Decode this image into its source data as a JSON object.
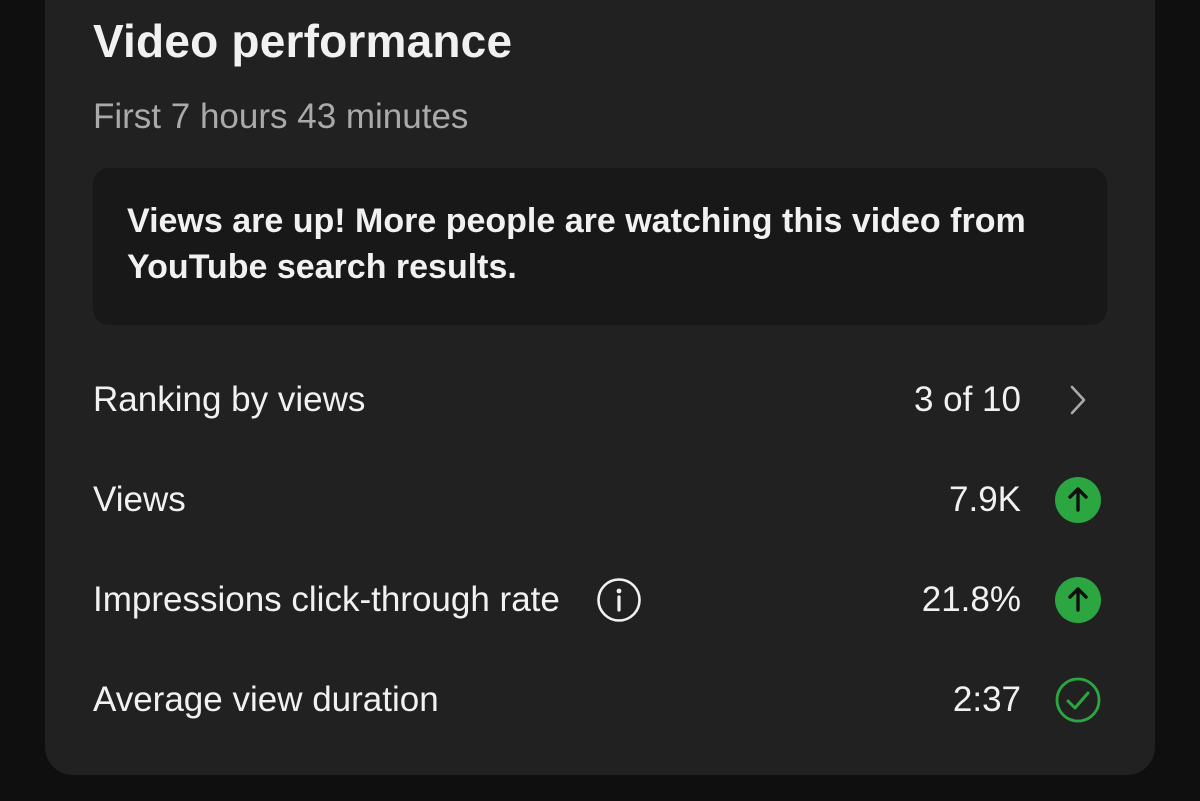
{
  "card": {
    "title": "Video performance",
    "subtitle": "First 7 hours 43 minutes",
    "banner_text": "Views are up! More people are watching this video from YouTube search results."
  },
  "metrics": [
    {
      "label": "Ranking by views",
      "value": "3 of 10",
      "icon": "chevron-right-icon"
    },
    {
      "label": "Views",
      "value": "7.9K",
      "icon": "arrow-up-circle-icon"
    },
    {
      "label": "Impressions click-through rate",
      "value": "21.8%",
      "icon": "arrow-up-circle-icon",
      "has_info": true
    },
    {
      "label": "Average view duration",
      "value": "2:37",
      "icon": "check-circle-icon"
    }
  ],
  "colors": {
    "background": "#0f0f0f",
    "card": "#212121",
    "banner": "#181818",
    "text_primary": "#f1f1f1",
    "text_secondary": "#aaaaaa",
    "positive_green": "#2ba640"
  }
}
